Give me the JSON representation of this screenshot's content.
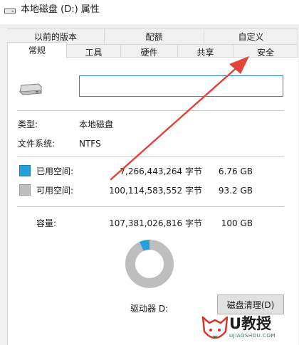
{
  "window": {
    "title": "本地磁盘 (D:) 属性"
  },
  "tabs": {
    "row_back": [
      "以前的版本",
      "配额",
      "自定义"
    ],
    "row_front": [
      "常规",
      "工具",
      "硬件",
      "共享",
      "安全"
    ],
    "active": "常规"
  },
  "general": {
    "name_value": "",
    "type_label": "类型:",
    "type_value": "本地磁盘",
    "fs_label": "文件系统:",
    "fs_value": "NTFS",
    "used_label": "已用空间:",
    "used_bytes": "7,266,443,264 字节",
    "used_size": "6.76 GB",
    "free_label": "可用空间:",
    "free_bytes": "100,114,583,552 字节",
    "free_size": "93.2 GB",
    "capacity_label": "容量:",
    "capacity_bytes": "107,381,026,816 字节",
    "capacity_size": "100 GB",
    "drive_label": "驱动器 D:",
    "cleanup_button": "磁盘清理(D)",
    "used_fraction": 0.0677
  },
  "colors": {
    "used": "#26a0da",
    "free": "#bebebe",
    "annotation_arrow": "#e0443a"
  },
  "watermark": {
    "main": "U教授",
    "sub": "UJIAOSHOU.COM"
  }
}
